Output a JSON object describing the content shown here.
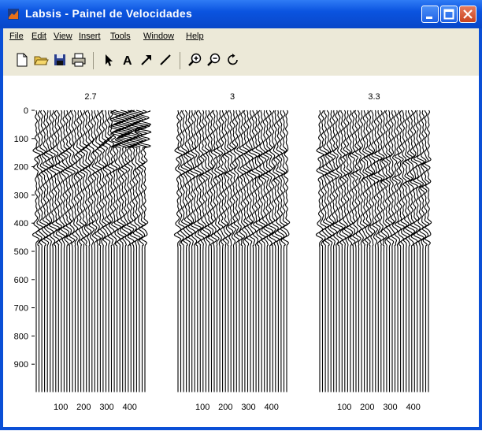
{
  "window": {
    "title": "Labsis - Painel de Velocidades"
  },
  "menu": [
    {
      "label": "File"
    },
    {
      "label": "Edit"
    },
    {
      "label": "View"
    },
    {
      "label": "Insert"
    },
    {
      "label": "Tools"
    },
    {
      "label": "Window"
    },
    {
      "label": "Help"
    }
  ],
  "toolbar": [
    {
      "icon": "new-file-icon"
    },
    {
      "icon": "open-folder-icon"
    },
    {
      "icon": "save-icon"
    },
    {
      "icon": "print-icon"
    },
    {
      "icon": "pointer-icon"
    },
    {
      "icon": "text-icon"
    },
    {
      "icon": "arrow-icon"
    },
    {
      "icon": "line-icon"
    },
    {
      "icon": "zoom-in-icon"
    },
    {
      "icon": "zoom-out-icon"
    },
    {
      "icon": "rotate-icon"
    }
  ],
  "colors": {
    "titlebar": "#0b54e0",
    "background": "#ece9d8",
    "trace": "#000000"
  },
  "chart_data": {
    "type": "seismic-wiggle",
    "panels": [
      {
        "title": "2.7",
        "event_behaviour": "hyperbolic-upcurving",
        "event_times": [
          150,
          210,
          410,
          450
        ]
      },
      {
        "title": "3",
        "event_behaviour": "flat",
        "event_times": [
          150,
          215,
          410,
          450
        ]
      },
      {
        "title": "3.3",
        "event_behaviour": "downcurving",
        "event_times": [
          150,
          220,
          410,
          450
        ]
      }
    ],
    "y_ticks": [
      "0",
      "100",
      "200",
      "300",
      "400",
      "500",
      "600",
      "700",
      "800",
      "900"
    ],
    "x_ticks": [
      "100",
      "200",
      "300",
      "400"
    ],
    "ylim": [
      0,
      1000
    ],
    "xlim": [
      0,
      480
    ],
    "traces_per_panel": 40
  }
}
